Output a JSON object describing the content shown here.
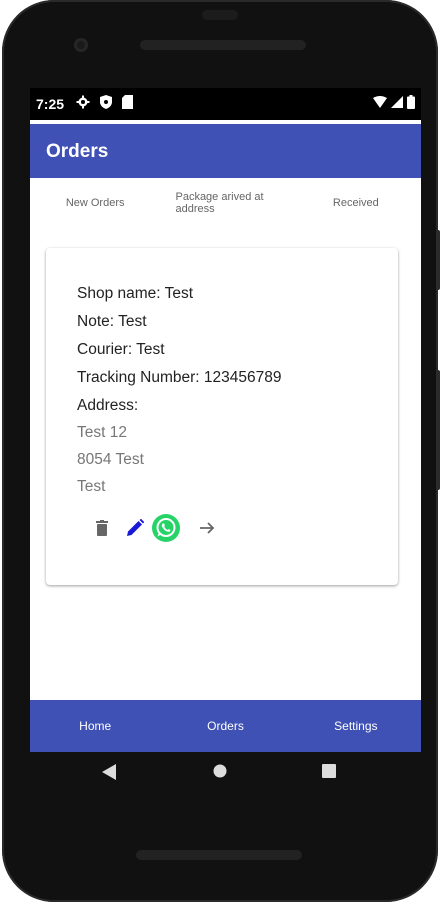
{
  "status_bar": {
    "time": "7:25",
    "icons": [
      "gear-icon",
      "shield-icon",
      "sd-card-icon"
    ],
    "right_icons": [
      "wifi-icon",
      "signal-icon",
      "battery-icon"
    ]
  },
  "app_bar": {
    "title": "Orders"
  },
  "tabs": [
    {
      "label": "New Orders"
    },
    {
      "label": "Package arived at address"
    },
    {
      "label": "Received"
    }
  ],
  "order": {
    "shop_name": "Shop name: Test",
    "note": "Note: Test",
    "courier": "Courier: Test",
    "tracking": "Tracking Number: 123456789",
    "address_label": "Address:",
    "address_line1": "Test 12",
    "address_line2": "8054 Test",
    "address_line3": "Test",
    "actions": [
      "delete-icon",
      "edit-icon",
      "whatsapp-icon",
      "arrow-forward-icon"
    ]
  },
  "bottom_nav": [
    {
      "label": "Home"
    },
    {
      "label": "Orders"
    },
    {
      "label": "Settings"
    }
  ],
  "system_nav": [
    "back-icon",
    "home-icon",
    "recents-icon"
  ],
  "colors": {
    "primary": "#3f51b5",
    "edit": "#1a1ad6",
    "whatsapp": "#25d366",
    "delete": "#666666"
  }
}
